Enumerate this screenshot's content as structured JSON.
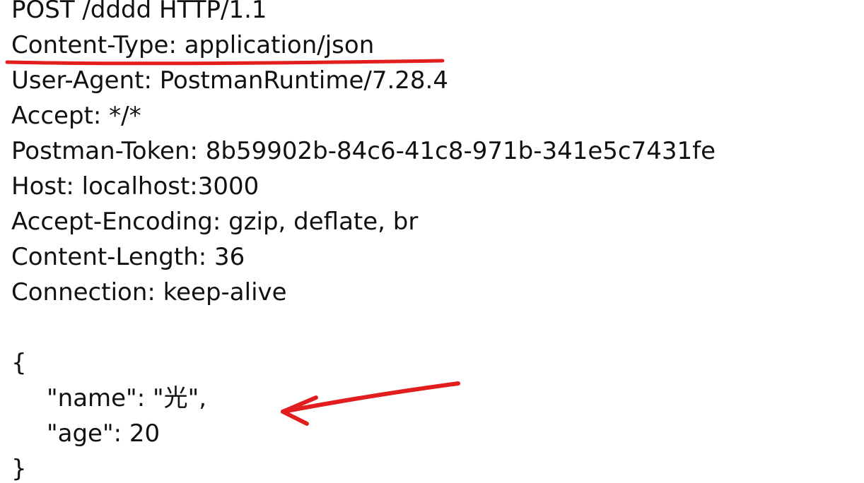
{
  "request": {
    "request_line": "POST /dddd HTTP/1.1",
    "headers": [
      "Content-Type: application/json",
      "User-Agent: PostmanRuntime/7.28.4",
      "Accept: */*",
      "Postman-Token: 8b59902b-84c6-41c8-971b-341e5c7431fe",
      "Host: localhost:3000",
      "Accept-Encoding: gzip, deflate, br",
      "Content-Length: 36",
      "Connection: keep-alive"
    ],
    "body": {
      "open_brace": "{",
      "lines": [
        "\"name\": \"光\",",
        "\"age\": 20"
      ],
      "close_brace": "}"
    }
  },
  "annotations": {
    "color": "#e11d1d",
    "underline_target": "Content-Type: application/json",
    "arrow_target": "\"name\": \"光\","
  }
}
